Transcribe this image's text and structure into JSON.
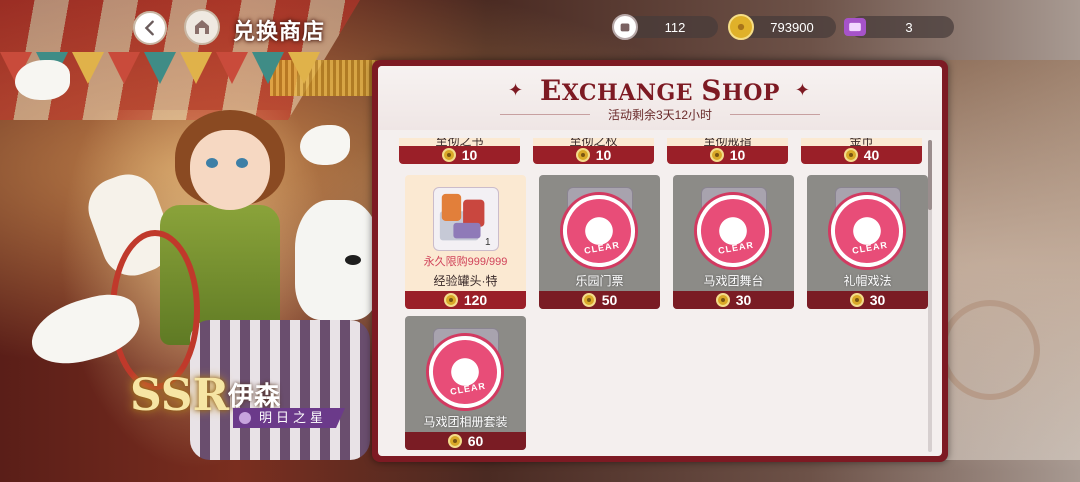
{
  "header": {
    "title": "兑换商店"
  },
  "currencies": [
    {
      "name": "ticket-currency",
      "value": "112"
    },
    {
      "name": "gold-coin-currency",
      "value": "793900"
    },
    {
      "name": "purple-ticket-currency",
      "value": "3"
    }
  ],
  "panel": {
    "title_first": "E",
    "title_rest": "XCHANGE ",
    "title_s": "S",
    "title_hop": "HOP",
    "time_remaining": "活动剩余3天12小时"
  },
  "items_top_row": [
    {
      "name": "至彻之书",
      "price": "10"
    },
    {
      "name": "至彻之权",
      "price": "10"
    },
    {
      "name": "至彻戒指",
      "price": "10"
    },
    {
      "name": "金币",
      "price": "40"
    }
  ],
  "items": [
    {
      "name": "经验罐头·特",
      "price": "120",
      "limit": "永久限购999/999",
      "qty": "1",
      "status": "available"
    },
    {
      "name": "乐园门票",
      "price": "50",
      "status": "sold",
      "stamp": "CLEAR"
    },
    {
      "name": "马戏团舞台",
      "price": "30",
      "status": "sold",
      "stamp": "CLEAR"
    },
    {
      "name": "礼帽戏法",
      "price": "30",
      "status": "sold",
      "stamp": "CLEAR"
    },
    {
      "name": "马戏团相册套装",
      "price": "60",
      "status": "sold",
      "stamp": "CLEAR"
    }
  ],
  "character": {
    "rarity": "SSR",
    "name": "伊森",
    "title": "明日之星"
  }
}
